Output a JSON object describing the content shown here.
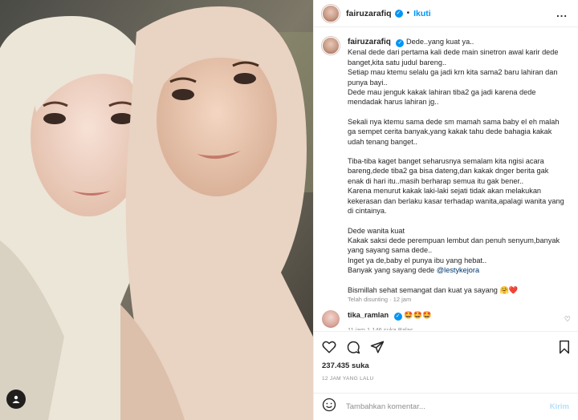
{
  "header": {
    "username": "fairuzarafiq",
    "dot": "•",
    "follow_label": "Ikuti",
    "more_label": "..."
  },
  "caption": {
    "username": "fairuzarafiq",
    "lines_1": [
      "Dede..yang kuat ya..",
      "Kenal dede dari pertama kali dede main sinetron awal karir dede banget,kita satu judul bareng..",
      "Setiap mau ktemu selalu ga jadi krn kita sama2 baru lahiran dan punya bayi..",
      "Dede mau jenguk kakak lahiran tiba2 ga jadi karena dede mendadak harus lahiran jg.."
    ],
    "lines_2": [
      "Sekali nya ktemu sama dede sm mamah sama baby el eh malah ga sempet cerita banyak,yang kakak tahu dede bahagia kakak udah tenang banget.."
    ],
    "lines_3": [
      "Tiba-tiba kaget banget seharusnya semalam kita ngisi acara bareng,dede tiba2 ga bisa dateng,dan kakak dnger berita gak enak di hari itu..masih berharap semua itu gak bener..",
      "Karena menurut kakak laki-laki sejati tidak akan melakukan kekerasan dan berlaku kasar terhadap wanita,apalagi wanita yang di cintainya."
    ],
    "lines_4": [
      "Dede wanita kuat",
      "Kakak saksi dede perempuan lembut dan penuh senyum,banyak yang sayang sama dede..",
      "Inget ya de,baby el punya ibu yang hebat.."
    ],
    "last_line_prefix": "Banyak yang sayang dede ",
    "mention": "@lestykejora",
    "closing": "Bismillah sehat semangat dan kuat ya sayang 🤗❤️",
    "edited": "Telah disunting · 12 jam"
  },
  "comment": {
    "username": "tika_ramlan",
    "text": "🤩🤩🤩",
    "meta": "11 jam  1.146 suka  Balas"
  },
  "actions": {
    "likes": "237.435 suka",
    "time": "12 JAM YANG LALU"
  },
  "comment_box": {
    "placeholder": "Tambahkan komentar...",
    "post_label": "Kirim"
  },
  "icons": [
    "heart-icon",
    "comment-icon",
    "share-icon",
    "bookmark-icon",
    "emoji-icon",
    "tag-user-icon",
    "more-icon",
    "verified-icon"
  ],
  "colors": {
    "accent": "#0095f6",
    "border": "#efefef",
    "muted": "#8e8e8e",
    "post_disabled": "#b2dffc"
  }
}
